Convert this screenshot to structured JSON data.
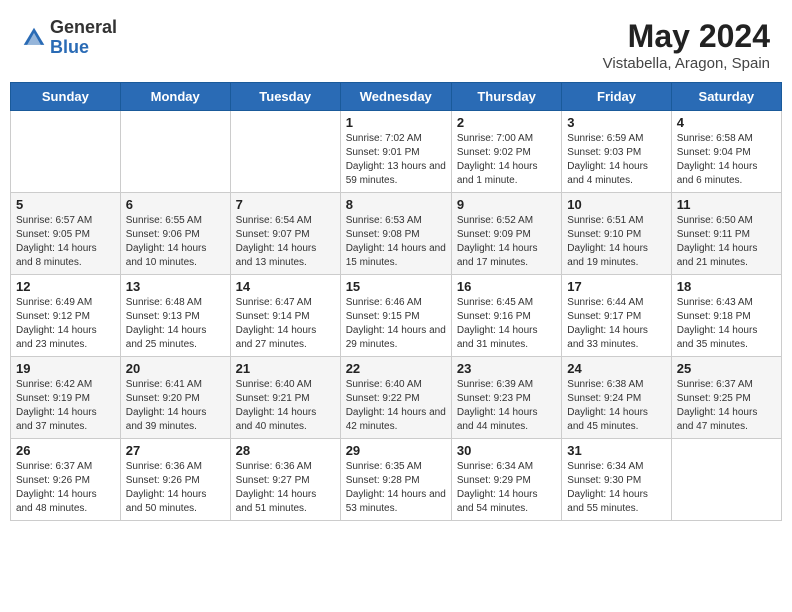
{
  "header": {
    "logo_general": "General",
    "logo_blue": "Blue",
    "month_year": "May 2024",
    "location": "Vistabella, Aragon, Spain"
  },
  "days_of_week": [
    "Sunday",
    "Monday",
    "Tuesday",
    "Wednesday",
    "Thursday",
    "Friday",
    "Saturday"
  ],
  "weeks": [
    [
      {
        "day": "",
        "info": ""
      },
      {
        "day": "",
        "info": ""
      },
      {
        "day": "",
        "info": ""
      },
      {
        "day": "1",
        "info": "Sunrise: 7:02 AM\nSunset: 9:01 PM\nDaylight: 13 hours and 59 minutes."
      },
      {
        "day": "2",
        "info": "Sunrise: 7:00 AM\nSunset: 9:02 PM\nDaylight: 14 hours and 1 minute."
      },
      {
        "day": "3",
        "info": "Sunrise: 6:59 AM\nSunset: 9:03 PM\nDaylight: 14 hours and 4 minutes."
      },
      {
        "day": "4",
        "info": "Sunrise: 6:58 AM\nSunset: 9:04 PM\nDaylight: 14 hours and 6 minutes."
      }
    ],
    [
      {
        "day": "5",
        "info": "Sunrise: 6:57 AM\nSunset: 9:05 PM\nDaylight: 14 hours and 8 minutes."
      },
      {
        "day": "6",
        "info": "Sunrise: 6:55 AM\nSunset: 9:06 PM\nDaylight: 14 hours and 10 minutes."
      },
      {
        "day": "7",
        "info": "Sunrise: 6:54 AM\nSunset: 9:07 PM\nDaylight: 14 hours and 13 minutes."
      },
      {
        "day": "8",
        "info": "Sunrise: 6:53 AM\nSunset: 9:08 PM\nDaylight: 14 hours and 15 minutes."
      },
      {
        "day": "9",
        "info": "Sunrise: 6:52 AM\nSunset: 9:09 PM\nDaylight: 14 hours and 17 minutes."
      },
      {
        "day": "10",
        "info": "Sunrise: 6:51 AM\nSunset: 9:10 PM\nDaylight: 14 hours and 19 minutes."
      },
      {
        "day": "11",
        "info": "Sunrise: 6:50 AM\nSunset: 9:11 PM\nDaylight: 14 hours and 21 minutes."
      }
    ],
    [
      {
        "day": "12",
        "info": "Sunrise: 6:49 AM\nSunset: 9:12 PM\nDaylight: 14 hours and 23 minutes."
      },
      {
        "day": "13",
        "info": "Sunrise: 6:48 AM\nSunset: 9:13 PM\nDaylight: 14 hours and 25 minutes."
      },
      {
        "day": "14",
        "info": "Sunrise: 6:47 AM\nSunset: 9:14 PM\nDaylight: 14 hours and 27 minutes."
      },
      {
        "day": "15",
        "info": "Sunrise: 6:46 AM\nSunset: 9:15 PM\nDaylight: 14 hours and 29 minutes."
      },
      {
        "day": "16",
        "info": "Sunrise: 6:45 AM\nSunset: 9:16 PM\nDaylight: 14 hours and 31 minutes."
      },
      {
        "day": "17",
        "info": "Sunrise: 6:44 AM\nSunset: 9:17 PM\nDaylight: 14 hours and 33 minutes."
      },
      {
        "day": "18",
        "info": "Sunrise: 6:43 AM\nSunset: 9:18 PM\nDaylight: 14 hours and 35 minutes."
      }
    ],
    [
      {
        "day": "19",
        "info": "Sunrise: 6:42 AM\nSunset: 9:19 PM\nDaylight: 14 hours and 37 minutes."
      },
      {
        "day": "20",
        "info": "Sunrise: 6:41 AM\nSunset: 9:20 PM\nDaylight: 14 hours and 39 minutes."
      },
      {
        "day": "21",
        "info": "Sunrise: 6:40 AM\nSunset: 9:21 PM\nDaylight: 14 hours and 40 minutes."
      },
      {
        "day": "22",
        "info": "Sunrise: 6:40 AM\nSunset: 9:22 PM\nDaylight: 14 hours and 42 minutes."
      },
      {
        "day": "23",
        "info": "Sunrise: 6:39 AM\nSunset: 9:23 PM\nDaylight: 14 hours and 44 minutes."
      },
      {
        "day": "24",
        "info": "Sunrise: 6:38 AM\nSunset: 9:24 PM\nDaylight: 14 hours and 45 minutes."
      },
      {
        "day": "25",
        "info": "Sunrise: 6:37 AM\nSunset: 9:25 PM\nDaylight: 14 hours and 47 minutes."
      }
    ],
    [
      {
        "day": "26",
        "info": "Sunrise: 6:37 AM\nSunset: 9:26 PM\nDaylight: 14 hours and 48 minutes."
      },
      {
        "day": "27",
        "info": "Sunrise: 6:36 AM\nSunset: 9:26 PM\nDaylight: 14 hours and 50 minutes."
      },
      {
        "day": "28",
        "info": "Sunrise: 6:36 AM\nSunset: 9:27 PM\nDaylight: 14 hours and 51 minutes."
      },
      {
        "day": "29",
        "info": "Sunrise: 6:35 AM\nSunset: 9:28 PM\nDaylight: 14 hours and 53 minutes."
      },
      {
        "day": "30",
        "info": "Sunrise: 6:34 AM\nSunset: 9:29 PM\nDaylight: 14 hours and 54 minutes."
      },
      {
        "day": "31",
        "info": "Sunrise: 6:34 AM\nSunset: 9:30 PM\nDaylight: 14 hours and 55 minutes."
      },
      {
        "day": "",
        "info": ""
      }
    ]
  ]
}
